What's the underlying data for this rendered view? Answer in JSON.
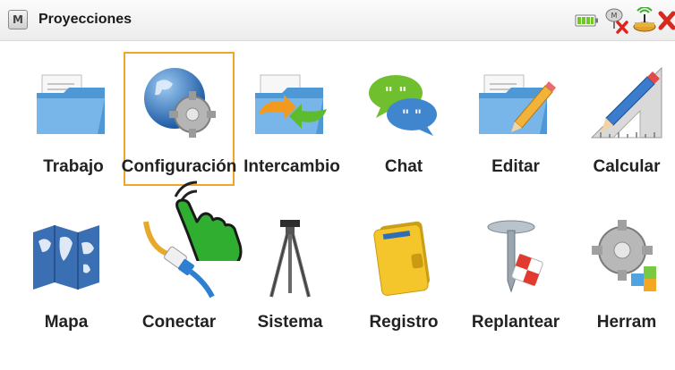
{
  "window": {
    "title": "Proyecciones",
    "logo": "M"
  },
  "status": {
    "battery_icon": "battery-icon",
    "connection_icon": "disconnected-receiver-icon",
    "radio_icon": "radio-antenna-icon",
    "close_icon": "close-icon"
  },
  "apps": [
    {
      "label": "Trabajo",
      "icon": "folder-document-icon"
    },
    {
      "label": "Configuración",
      "icon": "globe-gear-icon",
      "selected": true
    },
    {
      "label": "Intercambio",
      "icon": "folder-exchange-icon"
    },
    {
      "label": "Chat",
      "icon": "chat-bubbles-icon"
    },
    {
      "label": "Editar",
      "icon": "folder-pencil-icon"
    },
    {
      "label": "Calcular",
      "icon": "pencil-ruler-icon"
    },
    {
      "label": "Mapa",
      "icon": "world-map-icon"
    },
    {
      "label": "Conectar",
      "icon": "cable-icon"
    },
    {
      "label": "Sistema",
      "icon": "tripod-icon"
    },
    {
      "label": "Registro",
      "icon": "notebook-icon"
    },
    {
      "label": "Replantear",
      "icon": "survey-stake-icon"
    },
    {
      "label": "Herram",
      "icon": "tools-gear-icon"
    }
  ],
  "colors": {
    "selection": "#f0a62a",
    "hand": "#2fae2f"
  }
}
